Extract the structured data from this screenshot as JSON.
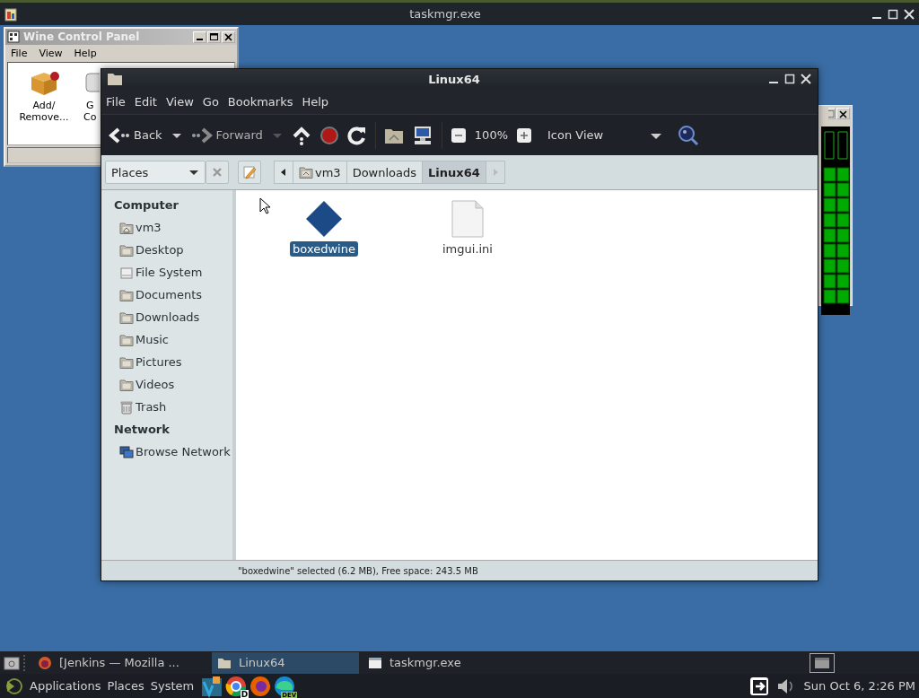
{
  "top_window": {
    "title": "taskmgr.exe"
  },
  "control_panel": {
    "title": "Wine Control Panel",
    "menu": [
      "File",
      "View",
      "Help"
    ],
    "items": [
      {
        "lines": [
          "Add/",
          "Remove..."
        ],
        "kind": "package"
      },
      {
        "lines": [
          "G",
          "Co"
        ],
        "kind": "controller"
      }
    ]
  },
  "file_manager": {
    "title": "Linux64",
    "menu": [
      "File",
      "Edit",
      "View",
      "Go",
      "Bookmarks",
      "Help"
    ],
    "toolbar": {
      "back": {
        "label": "Back",
        "disabled": false
      },
      "forward": {
        "label": "Forward",
        "disabled": true
      },
      "zoom": "100%",
      "view": "Icon View"
    },
    "places": "Places",
    "breadcrumbs": [
      {
        "label": "vm3",
        "kind": "home",
        "selected": false
      },
      {
        "label": "Downloads",
        "kind": "plain",
        "selected": false
      },
      {
        "label": "Linux64",
        "kind": "plain",
        "selected": true
      }
    ],
    "sidebar": [
      {
        "heading": "Computer",
        "items": [
          {
            "label": "vm3",
            "kind": "home"
          },
          {
            "label": "Desktop",
            "kind": "folder"
          },
          {
            "label": "File System",
            "kind": "drive"
          },
          {
            "label": "Documents",
            "kind": "folder"
          },
          {
            "label": "Downloads",
            "kind": "folder"
          },
          {
            "label": "Music",
            "kind": "folder"
          },
          {
            "label": "Pictures",
            "kind": "folder"
          },
          {
            "label": "Videos",
            "kind": "folder"
          },
          {
            "label": "Trash",
            "kind": "trash"
          }
        ]
      },
      {
        "heading": "Network",
        "items": [
          {
            "label": "Browse Network",
            "kind": "network"
          }
        ]
      }
    ],
    "files": [
      {
        "name": "boxedwine",
        "kind": "executable",
        "selected": true
      },
      {
        "name": "imgui.ini",
        "kind": "document",
        "selected": false
      }
    ],
    "status": "\"boxedwine\" selected (6.2 MB), Free space: 243.5 MB"
  },
  "taskbar": {
    "tasks": [
      {
        "label": "[Jenkins — Mozilla ...",
        "kind": "browser",
        "selected": false
      },
      {
        "label": "Linux64",
        "kind": "folder",
        "selected": true
      },
      {
        "label": "taskmgr.exe",
        "kind": "window",
        "selected": false
      }
    ]
  },
  "panel": {
    "menus": [
      "Applications",
      "Places",
      "System"
    ],
    "launchers": [
      {
        "kind": "editor"
      },
      {
        "kind": "ring",
        "badge": "D"
      },
      {
        "kind": "fox"
      },
      {
        "kind": "wave",
        "badge": "DEV"
      }
    ],
    "clock": "Sun Oct 6, 2:26 PM"
  }
}
